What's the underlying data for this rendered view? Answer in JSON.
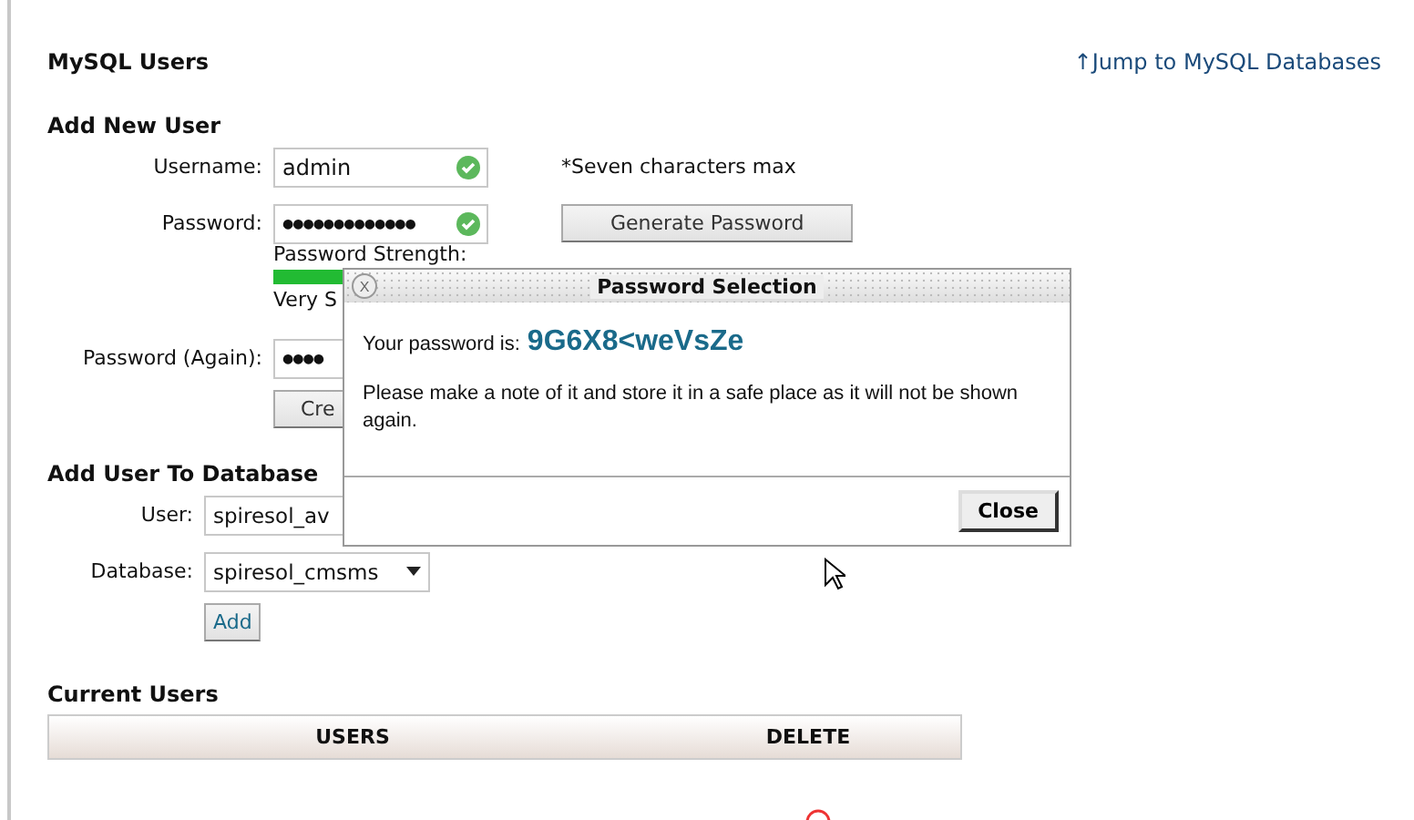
{
  "header": {
    "title": "MySQL Users",
    "jump_link": "↑Jump to MySQL Databases"
  },
  "add_user": {
    "title": "Add New User",
    "username": {
      "label": "Username:",
      "value": "admin",
      "valid": true
    },
    "note": "*Seven characters max",
    "password": {
      "label": "Password:",
      "value": "●●●●●●●●●●●●●",
      "valid": true
    },
    "generate_button": "Generate Password",
    "strength": {
      "label": "Password Strength:",
      "level": 1.0,
      "text": "Very S"
    },
    "password_again": {
      "label": "Password (Again):",
      "value": "●●●●"
    },
    "create_button": "Cre"
  },
  "add_to_db": {
    "title": "Add User To Database",
    "user": {
      "label": "User:",
      "value": "spiresol_av"
    },
    "database": {
      "label": "Database:",
      "value": "spiresol_cmsms"
    },
    "add_button": "Add"
  },
  "current_users": {
    "title": "Current Users",
    "columns": [
      "USERS",
      "DELETE"
    ]
  },
  "dialog": {
    "title": "Password Selection",
    "close_glyph": "X",
    "intro": "Your password is:",
    "password": "9G6X8<weVsZe",
    "message": "Please make a note of it and store it in a safe place as it will not be shown again.",
    "close_button": "Close"
  }
}
